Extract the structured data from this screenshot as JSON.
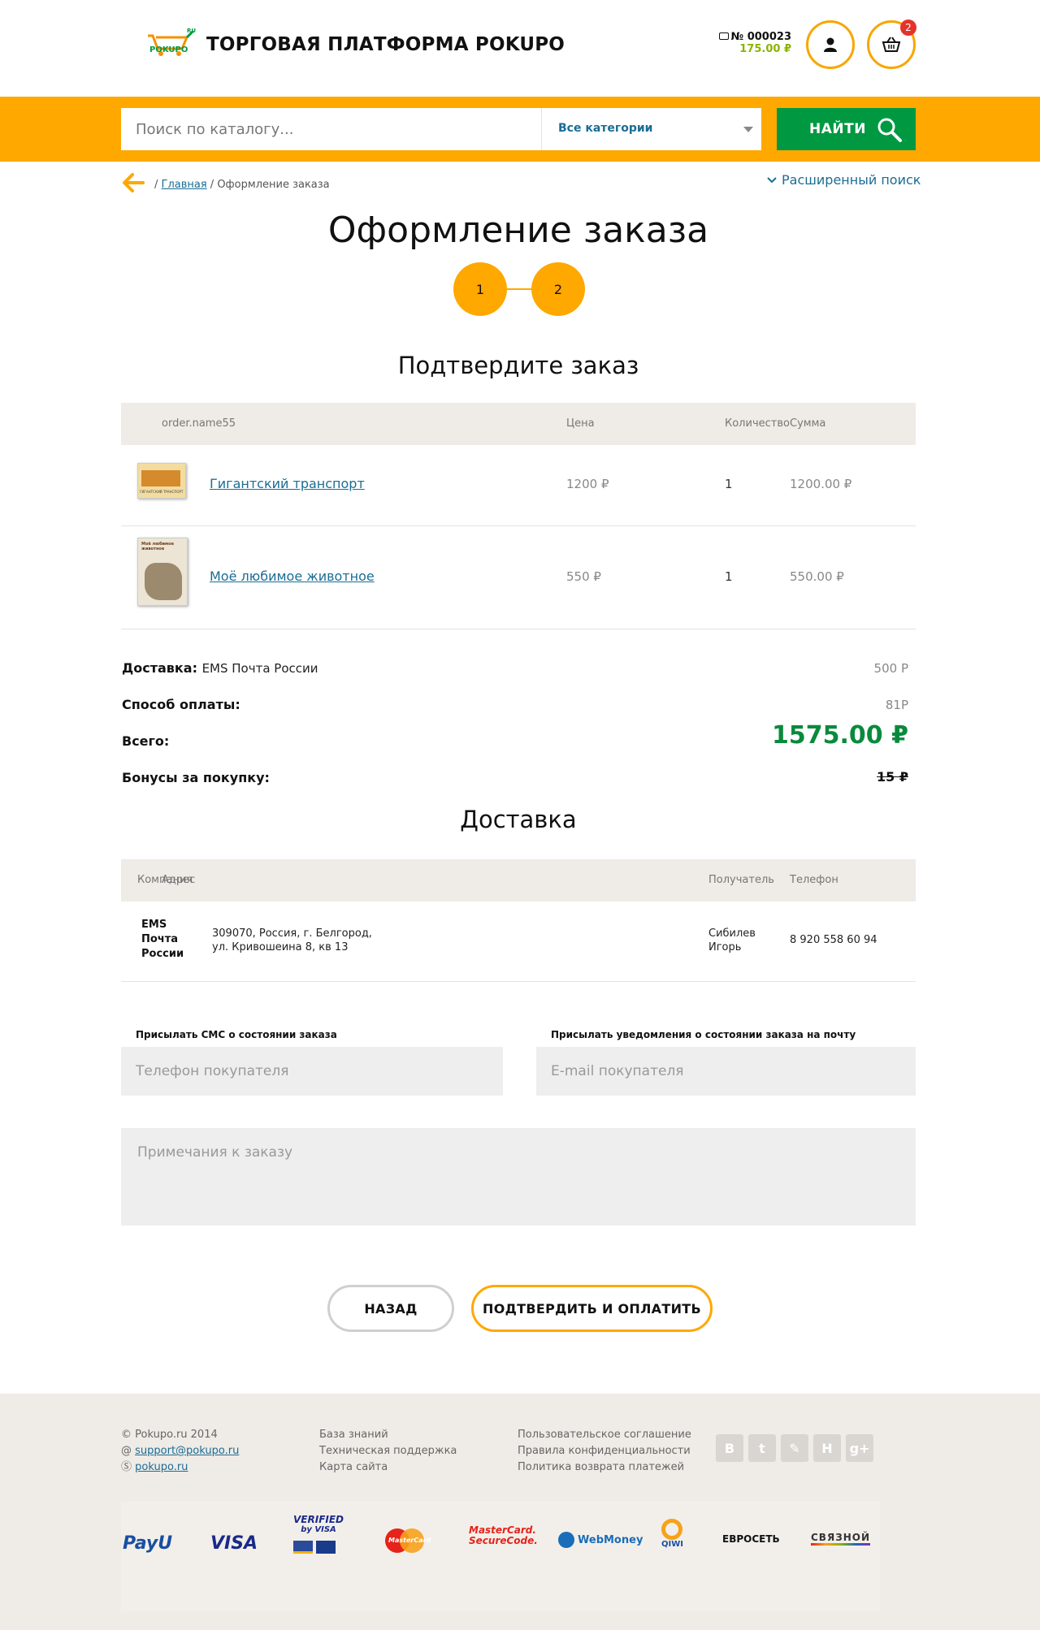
{
  "header": {
    "logo_text": "POKUPO",
    "logo_tld": "RU",
    "site_title": "ТОРГОВАЯ ПЛАТФОРМА POKUPO",
    "order_number": "№ 000023",
    "order_sum": "175.00 ₽",
    "cart_count": "2"
  },
  "search": {
    "placeholder": "Поиск по каталогу...",
    "category": "Все категории",
    "button": "НАЙТИ"
  },
  "breadcrumb": {
    "home": "Главная",
    "current": "Оформление заказа",
    "advanced_search": "Расширенный поиск"
  },
  "page": {
    "title": "Оформление заказа",
    "steps": [
      "1",
      "2"
    ]
  },
  "confirm": {
    "title": "Подтвердите заказ",
    "columns": {
      "name": "order.name55",
      "price": "Цена",
      "qty": "Количество",
      "sum": "Сумма"
    },
    "items": [
      {
        "name": "Гигантский транспорт",
        "price": "1200 ₽",
        "qty": "1",
        "sum": "1200.00 ₽",
        "cover_text": "ГИГАНТСКИЙ ТРАНСПОРТ"
      },
      {
        "name": "Моё любимое животное",
        "price": "550 ₽",
        "qty": "1",
        "sum": "550.00 ₽",
        "cover_text": "Моё любимое животное"
      }
    ]
  },
  "totals": {
    "delivery_label": "Доставка:",
    "delivery_value": "EMS Почта России",
    "delivery_price": "500 Р",
    "payment_label": "Способ оплаты:",
    "payment_price": "81Р",
    "total_label": "Всего:",
    "total_value": "1575.00 ₽",
    "bonus_label": "Бонусы за покупку:",
    "bonus_value": "15 ₽"
  },
  "delivery": {
    "title": "Доставка",
    "columns": {
      "company": "Компания",
      "address": "Адрес",
      "recipient": "Получатель",
      "phone": "Телефон"
    },
    "row": {
      "company_1": "EMS",
      "company_2": "Почта",
      "company_3": "России",
      "address_1": "309070, Россия, г. Белгород,",
      "address_2": "ул. Кривошеина 8, кв 13",
      "recipient_1": "Сибилев",
      "recipient_2": "Игорь",
      "phone": "8 920 558 60 94"
    }
  },
  "form": {
    "sms_label": "Присылать СМС о состоянии заказа",
    "sms_placeholder": "Телефон покупателя",
    "email_label": "Присылать уведомления о состоянии заказа на почту",
    "email_placeholder": "E-mail покупателя",
    "notes_placeholder": "Примечания к заказу"
  },
  "buttons": {
    "back": "НАЗАД",
    "confirm": "ПОДТВЕРДИТЬ И ОПЛАТИТЬ"
  },
  "footer": {
    "copyright": "Pokupo.ru 2014",
    "email": "support@pokupo.ru",
    "skype": "pokupo.ru",
    "col2": [
      "База знаний",
      "Техническая поддержка",
      "Карта сайта"
    ],
    "col3": [
      "Пользовательское соглашение",
      "Правила конфиденциальности",
      "Политика возврата платежей"
    ],
    "social": [
      "В",
      "t",
      "✎",
      "Н",
      "g+"
    ],
    "payments": {
      "payu": "PayU",
      "visa": "VISA",
      "verified_1": "VERIFIED",
      "verified_2": "by VISA",
      "mastercard": "MasterCard",
      "securecode_1": "MasterCard.",
      "securecode_2": "SecureCode.",
      "webmoney": "WebMoney",
      "qiwi": "QIWI",
      "euroset": "ЕВРОСЕТЬ",
      "svyaznoy": "СВЯЗНОЙ"
    }
  },
  "colors": {
    "accent": "#fea800",
    "green": "#009941",
    "link": "#1a6d95",
    "total": "#0a8a3c"
  }
}
